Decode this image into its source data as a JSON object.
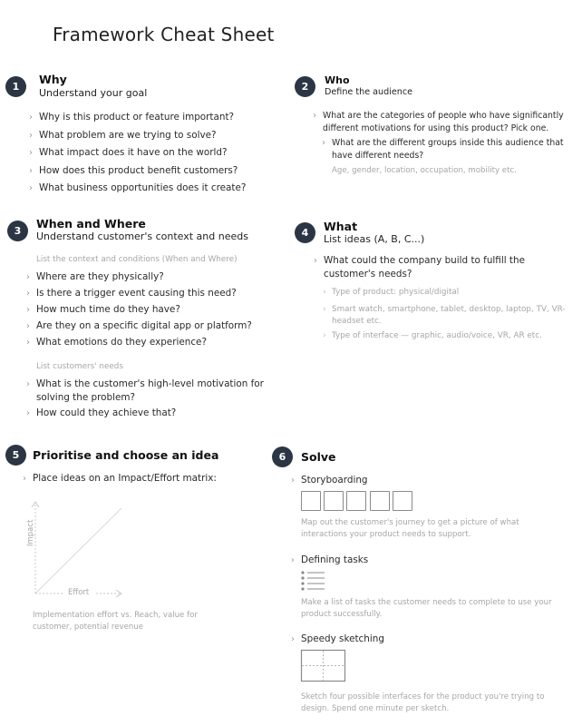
{
  "title": "Framework Cheat Sheet",
  "s1": {
    "num": "1",
    "title": "Why",
    "subtitle": "Understand your goal",
    "items": [
      "Why is this product or feature important?",
      "What problem are we trying to solve?",
      "What impact does it have on the world?",
      "How does this product benefit customers?",
      "What business opportunities does it create?"
    ]
  },
  "s2": {
    "num": "2",
    "title": "Who",
    "subtitle": "Define the audience",
    "item": "What are the categories of people who have significantly different motivations for using this product? Pick one.",
    "subitem": "What are the different groups inside this audience that have different needs?",
    "note": "Age, gender, location, occupation, mobility etc."
  },
  "s3": {
    "num": "3",
    "title": "When and Where",
    "subtitle": "Understand customer's context and needs",
    "head1": "List the context and conditions (When and Where)",
    "items1": [
      "Where are they physically?",
      "Is there a trigger event causing this need?",
      "How much time do they have?",
      "Are they on a specific digital app or platform?",
      "What emotions do they experience?"
    ],
    "head2": "List customers' needs",
    "items2": [
      "What is the customer's high-level motivation for solving the problem?",
      "How could they achieve that?"
    ]
  },
  "s4": {
    "num": "4",
    "title": "What",
    "subtitle": "List ideas (A, B, C...)",
    "item": "What could the company build to fulfill the customer's needs?",
    "subitems": [
      "Type of product: physical/digital",
      "Smart watch, smartphone, tablet, desktop, laptop, TV, VR-headset etc.",
      "Type of interface — graphic, audio/voice, VR, AR etc."
    ]
  },
  "s5": {
    "num": "5",
    "title": "Prioritise and choose an idea",
    "item": "Place ideas on an Impact/Effort matrix:",
    "y_axis": "Impact",
    "x_axis": "Effort",
    "note": "Implementation effort vs. Reach, value for customer, potential revenue"
  },
  "s6": {
    "num": "6",
    "title": "Solve",
    "storyboarding": "Storyboarding",
    "storyboarding_note": "Map out the customer's journey to get a picture of what interactions your product needs to support.",
    "tasks": "Defining tasks",
    "tasks_note": "Make a list of tasks the customer needs to complete to use your product successfully.",
    "sketching": "Speedy sketching",
    "sketching_note": "Sketch four possible interfaces for the product you're trying to design. Spend one minute per sketch."
  }
}
